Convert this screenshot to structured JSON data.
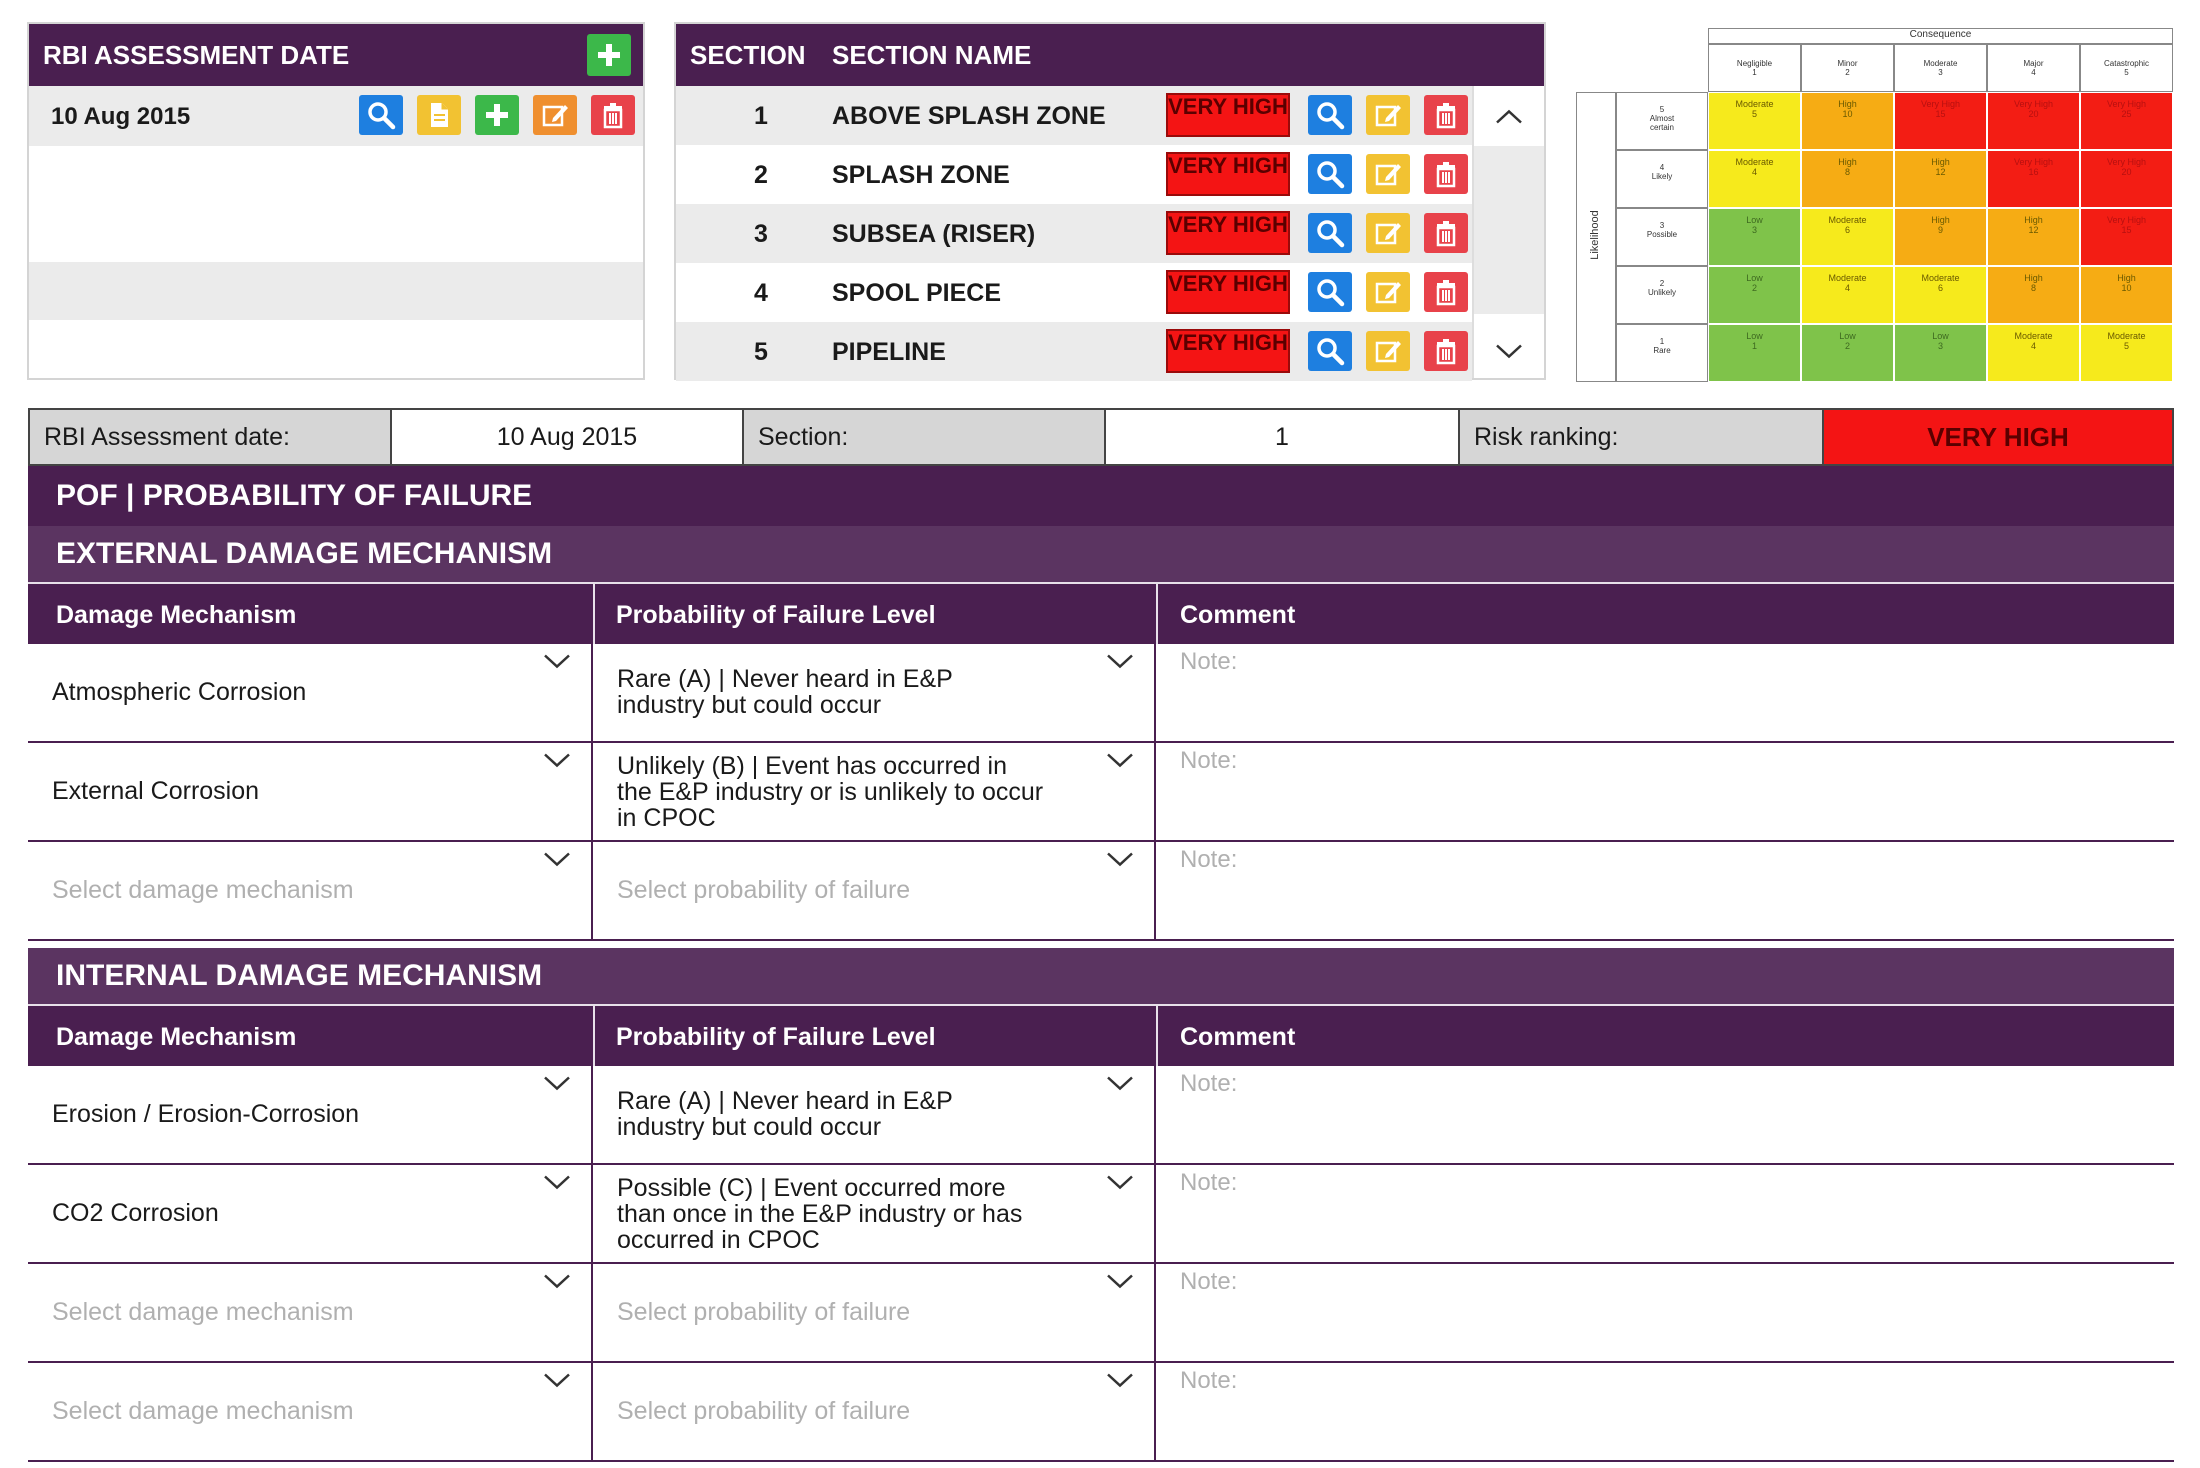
{
  "assessment_panel": {
    "title": "RBI ASSESSMENT DATE",
    "rows": [
      "10 Aug 2015",
      "",
      "",
      "",
      ""
    ]
  },
  "section_panel": {
    "col_section": "SECTION",
    "col_name": "SECTION NAME",
    "rows": [
      {
        "num": "1",
        "name": "ABOVE SPLASH ZONE",
        "risk": "VERY HIGH"
      },
      {
        "num": "2",
        "name": "SPLASH ZONE",
        "risk": "VERY HIGH"
      },
      {
        "num": "3",
        "name": "SUBSEA (RISER)",
        "risk": "VERY HIGH"
      },
      {
        "num": "4",
        "name": "SPOOL PIECE",
        "risk": "VERY HIGH"
      },
      {
        "num": "5",
        "name": "PIPELINE",
        "risk": "VERY HIGH"
      }
    ]
  },
  "risk_matrix": {
    "consequence_label": "Consequence",
    "likelihood_label": "Likelihood",
    "consequence_levels": [
      "Negligible\n1",
      "Minor\n2",
      "Moderate\n3",
      "Major\n4",
      "Catastrophic\n5"
    ],
    "likelihood_levels": [
      "5\nAlmost\ncertain",
      "4\nLikely",
      "3\nPossible",
      "2\nUnlikely",
      "1\nRare"
    ],
    "cells": [
      [
        {
          "t": "Moderate\n5",
          "c": "y"
        },
        {
          "t": "High\n10",
          "c": "o"
        },
        {
          "t": "Very High\n15",
          "c": "r"
        },
        {
          "t": "Very High\n20",
          "c": "r"
        },
        {
          "t": "Very High\n25",
          "c": "r"
        }
      ],
      [
        {
          "t": "Moderate\n4",
          "c": "y"
        },
        {
          "t": "High\n8",
          "c": "o"
        },
        {
          "t": "High\n12",
          "c": "o"
        },
        {
          "t": "Very High\n16",
          "c": "r"
        },
        {
          "t": "Very High\n20",
          "c": "r"
        }
      ],
      [
        {
          "t": "Low\n3",
          "c": "g"
        },
        {
          "t": "Moderate\n6",
          "c": "y"
        },
        {
          "t": "High\n9",
          "c": "o"
        },
        {
          "t": "High\n12",
          "c": "o"
        },
        {
          "t": "Very High\n15",
          "c": "r"
        }
      ],
      [
        {
          "t": "Low\n2",
          "c": "g"
        },
        {
          "t": "Moderate\n4",
          "c": "y"
        },
        {
          "t": "Moderate\n6",
          "c": "y"
        },
        {
          "t": "High\n8",
          "c": "o"
        },
        {
          "t": "High\n10",
          "c": "o"
        }
      ],
      [
        {
          "t": "Low\n1",
          "c": "g"
        },
        {
          "t": "Low\n2",
          "c": "g"
        },
        {
          "t": "Low\n3",
          "c": "g"
        },
        {
          "t": "Moderate\n4",
          "c": "y"
        },
        {
          "t": "Moderate\n5",
          "c": "y"
        }
      ]
    ]
  },
  "info_bar": {
    "date_label": "RBI Assessment date:",
    "date_value": "10 Aug 2015",
    "section_label": "Section:",
    "section_value": "1",
    "risk_label": "Risk ranking:",
    "risk_value": "VERY HIGH"
  },
  "pof": {
    "title": "POF | PROBABILITY OF FAILURE",
    "headers": {
      "mechanism": "Damage Mechanism",
      "level": "Probability of Failure Level",
      "comment": "Comment"
    },
    "external": {
      "title": "EXTERNAL DAMAGE MECHANISM",
      "rows": [
        {
          "mechanism": "Atmospheric Corrosion",
          "level": "Rare (A) | Never heard in E&P\nindustry but could occur",
          "note": "Note:",
          "empty": false
        },
        {
          "mechanism": "External Corrosion",
          "level": "Unlikely (B) | Event has occurred in\nthe E&P industry or is unlikely to occur\nin CPOC",
          "note": "Note:",
          "empty": false
        },
        {
          "mechanism": "Select damage mechanism",
          "level": "Select probability of failure",
          "note": "Note:",
          "empty": true
        }
      ]
    },
    "internal": {
      "title": "INTERNAL DAMAGE MECHANISM",
      "rows": [
        {
          "mechanism": "Erosion / Erosion-Corrosion",
          "level": "Rare (A) | Never heard in E&P\nindustry but could occur",
          "note": "Note:",
          "empty": false
        },
        {
          "mechanism": "CO2 Corrosion",
          "level": "Possible (C) | Event occurred more\nthan once in the E&P industry or has\noccurred in CPOC",
          "note": "Note:",
          "empty": false
        },
        {
          "mechanism": "Select damage mechanism",
          "level": "Select probability of failure",
          "note": "Note:",
          "empty": true
        },
        {
          "mechanism": "Select damage mechanism",
          "level": "Select probability of failure",
          "note": "Note:",
          "empty": true
        }
      ]
    }
  },
  "colors": {
    "purple": "#4a1f50",
    "very_high": "#f41414",
    "moderate": "#f6ea1c",
    "high": "#f6ac14",
    "low": "#7fc34a"
  }
}
